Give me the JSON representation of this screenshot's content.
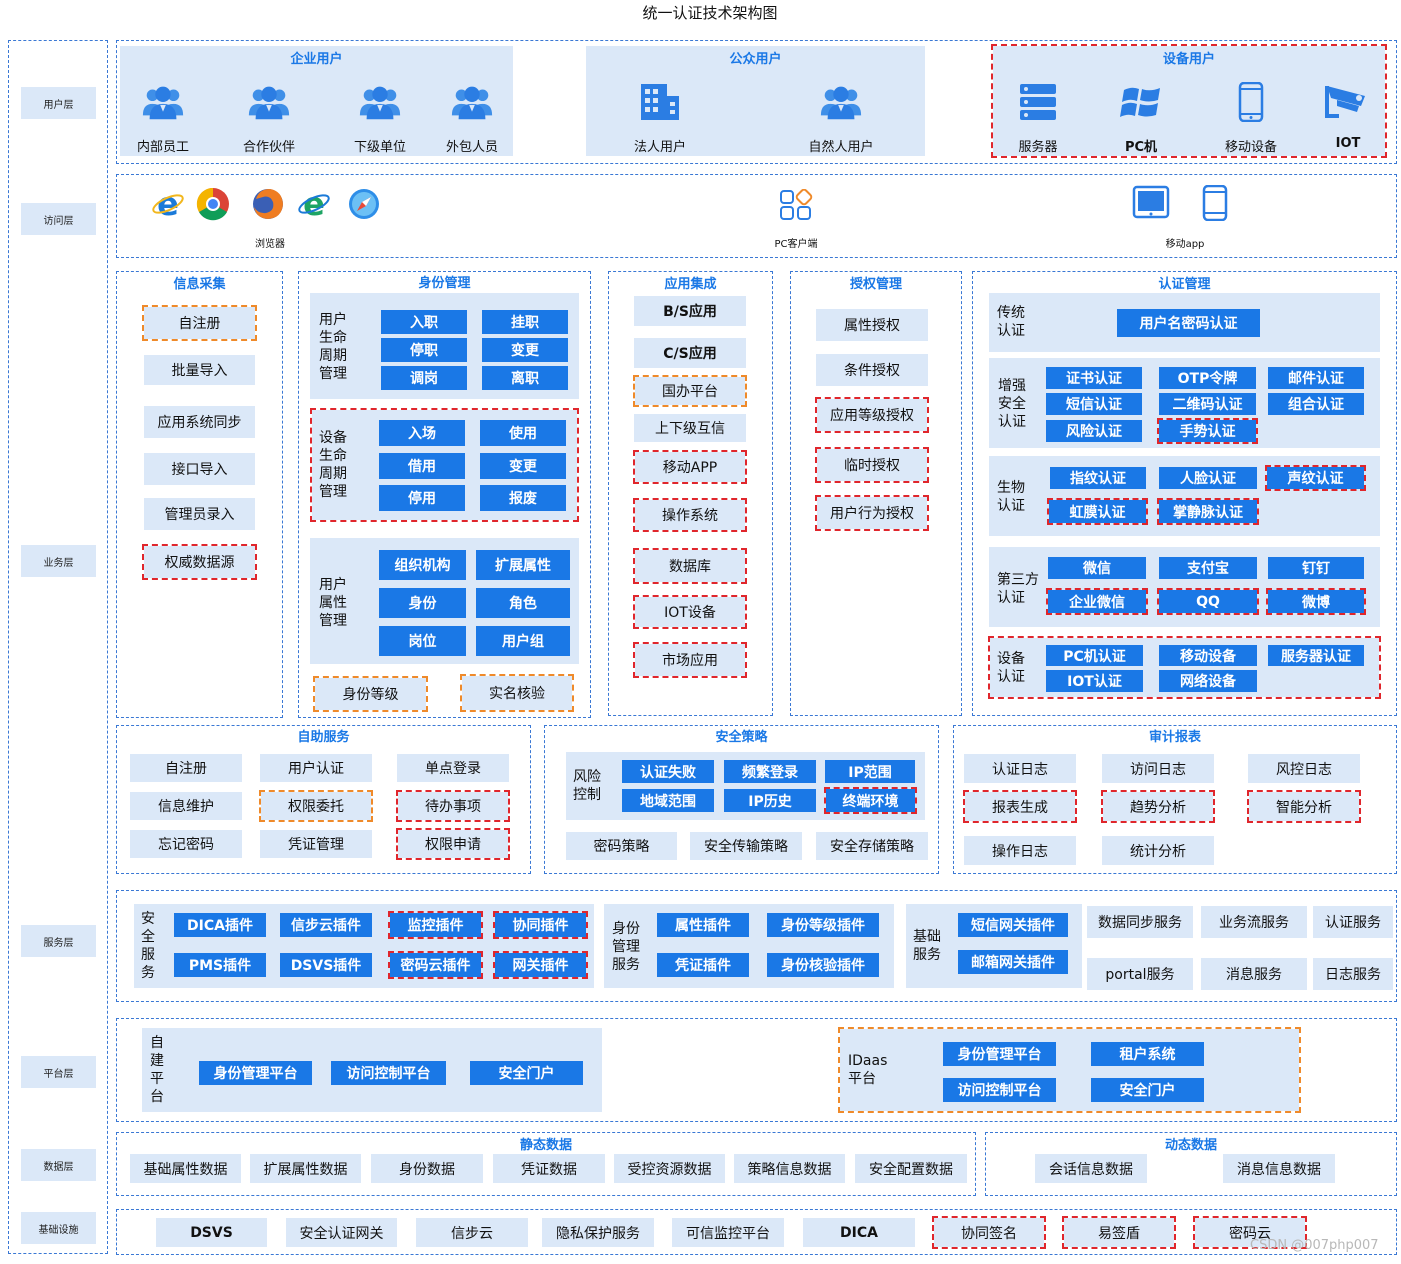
{
  "title": "统一认证技术架构图",
  "watermark": "CSDN @007php007",
  "layers": [
    "用户层",
    "访问层",
    "业务层",
    "服务层",
    "平台层",
    "数据层",
    "基础设施"
  ],
  "user_layer": {
    "enterprise": {
      "title": "企业用户",
      "items": [
        "内部员工",
        "合作伙伴",
        "下级单位",
        "外包人员"
      ]
    },
    "public": {
      "title": "公众用户",
      "items": [
        "法人用户",
        "自然人用户"
      ]
    },
    "device": {
      "title": "设备用户",
      "items": [
        "服务器",
        "PC机",
        "移动设备",
        "IOT"
      ]
    }
  },
  "access_layer": {
    "browser": "浏览器",
    "pc": "PC客户端",
    "mobile": "移动app"
  },
  "info_collect": {
    "title": "信息采集",
    "items": [
      "自注册",
      "批量导入",
      "应用系统同步",
      "接口导入",
      "管理员录入",
      "权威数据源"
    ]
  },
  "identity": {
    "title": "身份管理",
    "lifecycle": {
      "label": "用户生命周期管理",
      "items": [
        "入职",
        "挂职",
        "停职",
        "变更",
        "调岗",
        "离职"
      ]
    },
    "device_lifecycle": {
      "label": "设备生命周期管理",
      "items": [
        "入场",
        "使用",
        "借用",
        "变更",
        "停用",
        "报废"
      ]
    },
    "attr": {
      "label": "用户属性管理",
      "items": [
        "组织机构",
        "扩展属性",
        "身份",
        "角色",
        "岗位",
        "用户组"
      ]
    },
    "bottom": [
      "身份等级",
      "实名核验"
    ]
  },
  "app_integration": {
    "title": "应用集成",
    "items": [
      "B/S应用",
      "C/S应用",
      "国办平台",
      "上下级互信",
      "移动APP",
      "操作系统",
      "数据库",
      "IOT设备",
      "市场应用"
    ]
  },
  "authorization": {
    "title": "授权管理",
    "items": [
      "属性授权",
      "条件授权",
      "应用等级授权",
      "临时授权",
      "用户行为授权"
    ]
  },
  "auth_mgmt": {
    "title": "认证管理",
    "traditional": {
      "label": "传统认证",
      "items": [
        "用户名密码认证"
      ]
    },
    "enhanced": {
      "label": "增强安全认证",
      "items": [
        "证书认证",
        "OTP令牌",
        "邮件认证",
        "短信认证",
        "二维码认证",
        "组合认证",
        "风险认证",
        "手势认证"
      ]
    },
    "bio": {
      "label": "生物认证",
      "items": [
        "指纹认证",
        "人脸认证",
        "声纹认证",
        "虹膜认证",
        "掌静脉认证"
      ]
    },
    "third": {
      "label": "第三方认证",
      "items": [
        "微信",
        "支付宝",
        "钉钉",
        "企业微信",
        "QQ",
        "微博"
      ]
    },
    "device": {
      "label": "设备认证",
      "items": [
        "PC机认证",
        "移动设备",
        "服务器认证",
        "IOT认证",
        "网络设备"
      ]
    }
  },
  "self_service": {
    "title": "自助服务",
    "items": [
      "自注册",
      "用户认证",
      "单点登录",
      "信息维护",
      "权限委托",
      "待办事项",
      "忘记密码",
      "凭证管理",
      "权限申请"
    ]
  },
  "security_policy": {
    "title": "安全策略",
    "risk_label": "风险控制",
    "risk_items": [
      "认证失败",
      "频繁登录",
      "IP范围",
      "地域范围",
      "IP历史",
      "终端环境"
    ],
    "bottom": [
      "密码策略",
      "安全传输策略",
      "安全存储策略"
    ]
  },
  "audit": {
    "title": "审计报表",
    "items": [
      "认证日志",
      "访问日志",
      "风控日志",
      "报表生成",
      "趋势分析",
      "智能分析",
      "操作日志",
      "统计分析"
    ]
  },
  "service_layer": {
    "security": {
      "label": "安全服务",
      "items": [
        "DICA插件",
        "信步云插件",
        "监控插件",
        "协同插件",
        "PMS插件",
        "DSVS插件",
        "密码云插件",
        "网关插件"
      ]
    },
    "identity": {
      "label": "身份管理服务",
      "items": [
        "属性插件",
        "身份等级插件",
        "凭证插件",
        "身份核验插件"
      ]
    },
    "basic": {
      "label": "基础服务",
      "items": [
        "短信网关插件",
        "邮箱网关插件"
      ]
    },
    "others": [
      "数据同步服务",
      "业务流服务",
      "认证服务",
      "portal服务",
      "消息服务",
      "日志服务"
    ]
  },
  "platform": {
    "self": {
      "label": "自建平台",
      "items": [
        "身份管理平台",
        "访问控制平台",
        "安全门户"
      ]
    },
    "idaas": {
      "label": "IDaas平台",
      "items": [
        "身份管理平台",
        "租户系统",
        "访问控制平台",
        "安全门户"
      ]
    }
  },
  "data_layer": {
    "static": {
      "title": "静态数据",
      "items": [
        "基础属性数据",
        "扩展属性数据",
        "身份数据",
        "凭证数据",
        "受控资源数据",
        "策略信息数据",
        "安全配置数据"
      ]
    },
    "dynamic": {
      "title": "动态数据",
      "items": [
        "会话信息数据",
        "消息信息数据"
      ]
    }
  },
  "infra": {
    "items": [
      "DSVS",
      "安全认证网关",
      "信步云",
      "隐私保护服务",
      "可信监控平台",
      "DICA",
      "协同签名",
      "易签盾",
      "密码云"
    ]
  },
  "colors": {
    "accent": "#1a78e6",
    "panel": "#dbe8f8",
    "dash_blue": "#3a78d4",
    "dash_red": "#e0262c",
    "dash_orange": "#ef8a2a"
  }
}
